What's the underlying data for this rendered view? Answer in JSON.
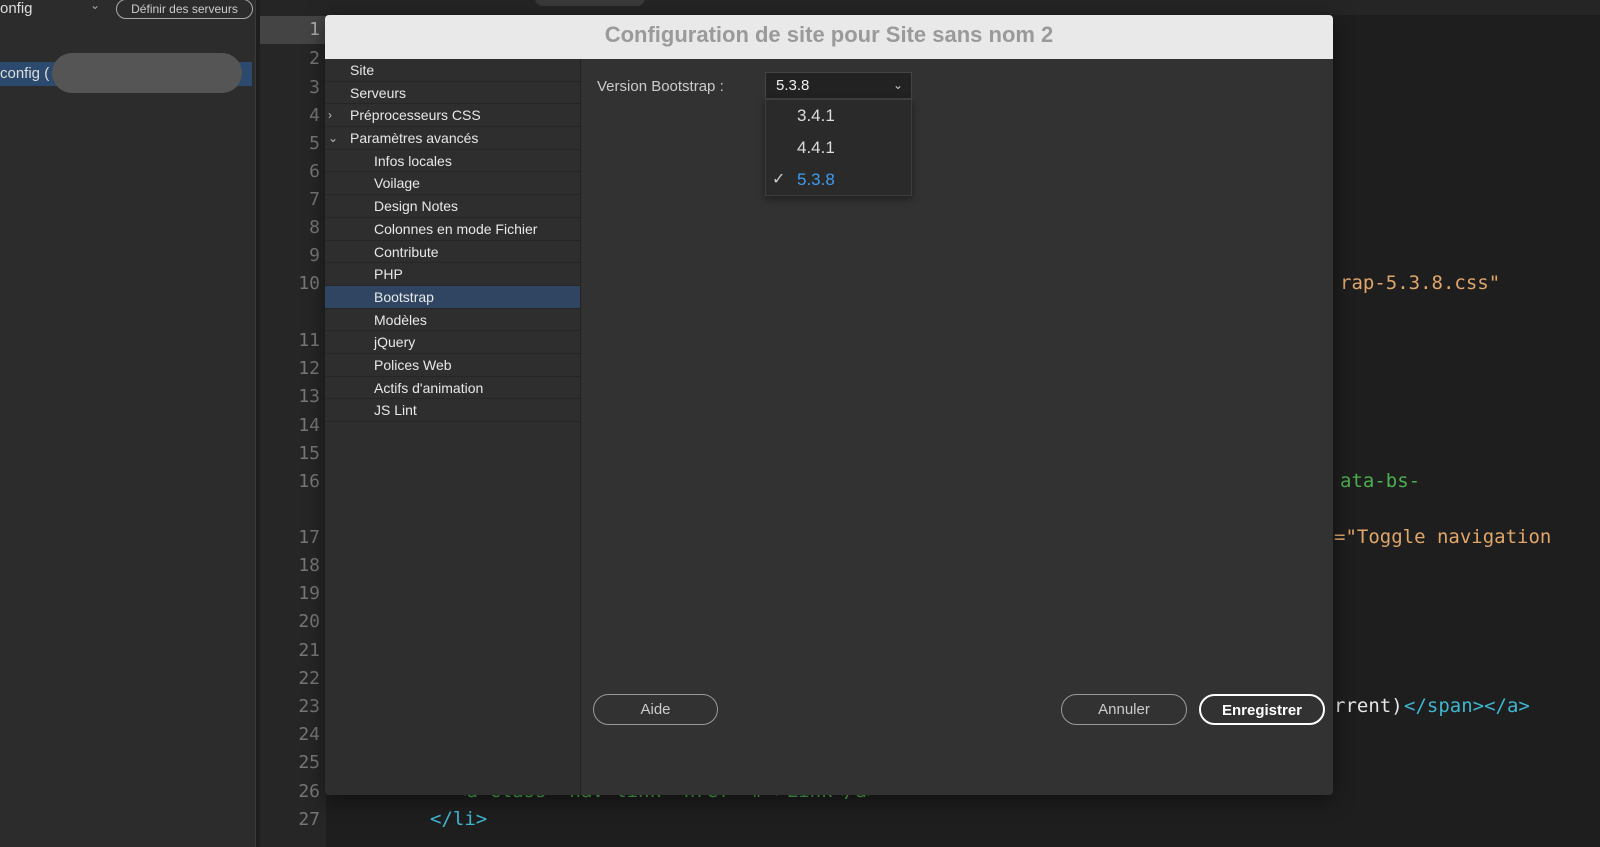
{
  "left_panel": {
    "site_select": "onfig",
    "define_servers": "Définir des serveurs",
    "tree_item": "config ("
  },
  "editor": {
    "line_numbers": [
      "1",
      "2",
      "3",
      "4",
      "5",
      "6",
      "7",
      "8",
      "9",
      "10",
      "11",
      "12",
      "13",
      "14",
      "15",
      "16",
      "17",
      "18",
      "19",
      "20",
      "21",
      "22",
      "23",
      "24",
      "25",
      "26",
      "27"
    ],
    "fragments": [
      {
        "text": "rap-5.3.8.css\"",
        "color": "#e0a66a"
      },
      {
        "text": "ata-bs-",
        "color": "#4caf50"
      },
      {
        "text": "=\"Toggle navigation",
        "color": "#e0a66a"
      },
      {
        "text": "rrent)",
        "color": "#e6e6e6"
      },
      {
        "text": "</span></a>",
        "color": "#3fb6d0"
      },
      {
        "text": "<a class=\"nav-link\" href=\"#\">Link</a>",
        "color": "#4caf50"
      },
      {
        "text": "</li>",
        "color": "#3fb6d0"
      }
    ]
  },
  "dialog": {
    "title": "Configuration de site pour Site sans nom 2",
    "sidebar": [
      {
        "label": "Site",
        "level": 0
      },
      {
        "label": "Serveurs",
        "level": 0
      },
      {
        "label": "Préprocesseurs CSS",
        "level": 0,
        "arrow": "›"
      },
      {
        "label": "Paramètres avancés",
        "level": 0,
        "arrow": "⌄"
      },
      {
        "label": "Infos locales",
        "level": 1
      },
      {
        "label": "Voilage",
        "level": 1
      },
      {
        "label": "Design Notes",
        "level": 1
      },
      {
        "label": "Colonnes en mode Fichier",
        "level": 1
      },
      {
        "label": "Contribute",
        "level": 1
      },
      {
        "label": "PHP",
        "level": 1
      },
      {
        "label": "Bootstrap",
        "level": 1,
        "active": true
      },
      {
        "label": "Modèles",
        "level": 1
      },
      {
        "label": "jQuery",
        "level": 1
      },
      {
        "label": "Polices Web",
        "level": 1
      },
      {
        "label": "Actifs d'animation",
        "level": 1
      },
      {
        "label": "JS Lint",
        "level": 1
      }
    ],
    "version_label": "Version Bootstrap :",
    "version_value": "5.3.8",
    "options": [
      "3.4.1",
      "4.4.1",
      "5.3.8"
    ],
    "buttons": {
      "help": "Aide",
      "cancel": "Annuler",
      "save": "Enregistrer"
    }
  }
}
